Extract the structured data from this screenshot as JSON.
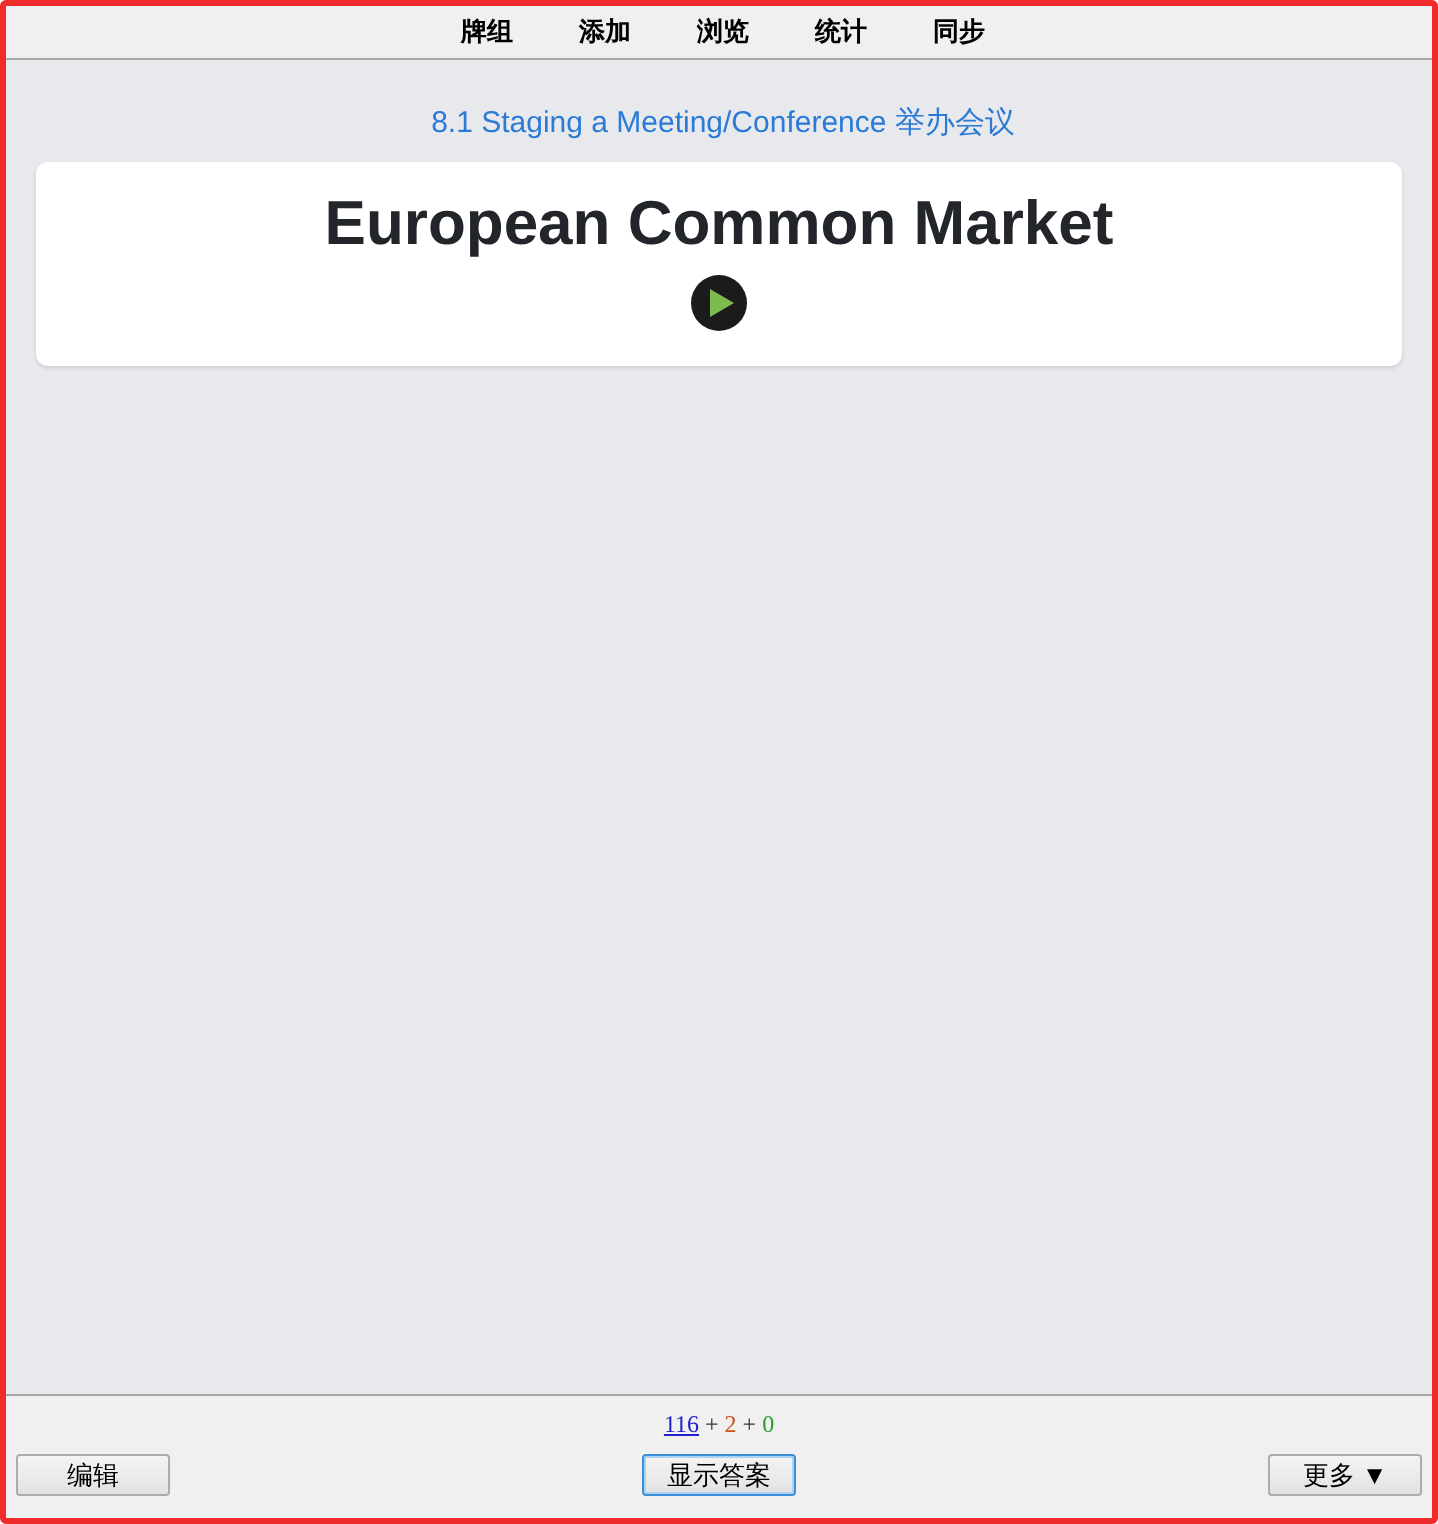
{
  "menu": [
    {
      "label": "牌组"
    },
    {
      "label": "添加"
    },
    {
      "label": "浏览"
    },
    {
      "label": "统计"
    },
    {
      "label": "同步"
    }
  ],
  "deck_title": "8.1 Staging a Meeting/Conference 举办会议",
  "card": {
    "front": "European Common Market",
    "audio": true
  },
  "bottom_bar": {
    "counts": [
      {
        "text": "116",
        "color": "#2222cc",
        "selected": true
      },
      {
        "text": "2",
        "color": "#c8561a",
        "selected": false
      },
      {
        "text": "0",
        "color": "#2aa02a",
        "selected": false
      }
    ],
    "separators": [
      "+",
      "+"
    ],
    "edit_button": {
      "label": "编辑",
      "focused": false
    },
    "answer_button": {
      "label": "显示答案",
      "focused": true
    },
    "more_button": {
      "label": "更多 ▼",
      "focused": false
    }
  }
}
